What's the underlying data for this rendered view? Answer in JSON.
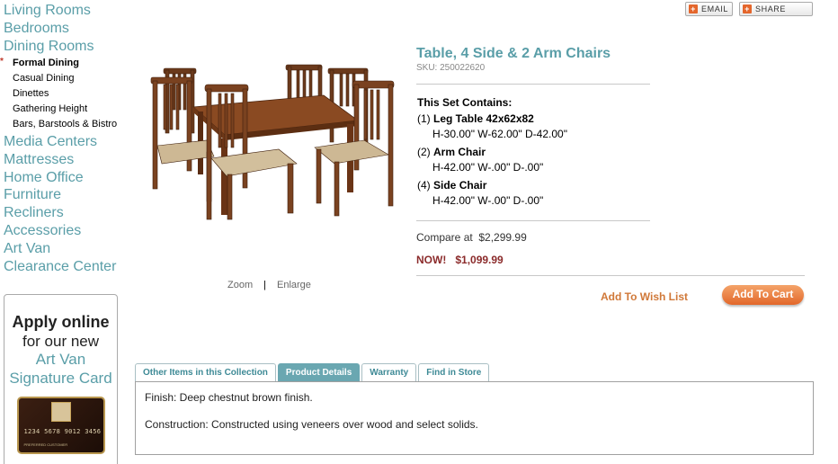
{
  "nav": {
    "top_categories": [
      "Living Rooms",
      "Bedrooms",
      "Dining Rooms"
    ],
    "dining_subcategories": [
      "Formal Dining",
      "Casual Dining",
      "Dinettes",
      "Gathering Height",
      "Bars, Barstools & Bistro"
    ],
    "active_subcategory": "Formal Dining",
    "more_categories": [
      "Media Centers",
      "Mattresses",
      "Home Office",
      "Furniture",
      "Recliners",
      "Accessories",
      "Art Van",
      "Clearance Center"
    ]
  },
  "promo": {
    "line1": "Apply online",
    "line2": "for our new",
    "line3": "Art Van",
    "line4": "Signature Card",
    "card_number": "1234 5678 9012 3456",
    "card_name": "PREFERRED CUSTOMER"
  },
  "share": {
    "email_label": "EMAIL",
    "share_label": "SHARE"
  },
  "product": {
    "title": "Table, 4 Side & 2 Arm Chairs",
    "sku": "SKU: 250022620",
    "contains_heading": "This Set Contains:",
    "items": [
      {
        "qty": "(1)",
        "name": "Leg Table 42x62x82",
        "dims": "H-30.00\" W-62.00\" D-42.00\""
      },
      {
        "qty": "(2)",
        "name": "Arm Chair",
        "dims": "H-42.00\" W-.00\" D-.00\""
      },
      {
        "qty": "(4)",
        "name": "Side Chair",
        "dims": "H-42.00\" W-.00\" D-.00\""
      }
    ],
    "compare_label": "Compare at",
    "compare_price": "$2,299.99",
    "now_label": "NOW!",
    "now_price": "$1,099.99"
  },
  "image_controls": {
    "zoom": "Zoom",
    "separator": "|",
    "enlarge": "Enlarge"
  },
  "actions": {
    "wish_list": "Add To Wish List",
    "add_to_cart": "Add To Cart"
  },
  "tabs": {
    "labels": [
      "Other Items in this Collection",
      "Product Details",
      "Warranty",
      "Find in Store"
    ],
    "active": "Product Details",
    "content": [
      "Finish: Deep chestnut brown finish.",
      "Construction: Constructed using veneers over wood and select solids."
    ]
  },
  "colors": {
    "nav_link": "#5a9ea8",
    "now_price": "#8b2b2b",
    "cart_button": "#e2672a",
    "active_tab": "#6aa7b1"
  }
}
